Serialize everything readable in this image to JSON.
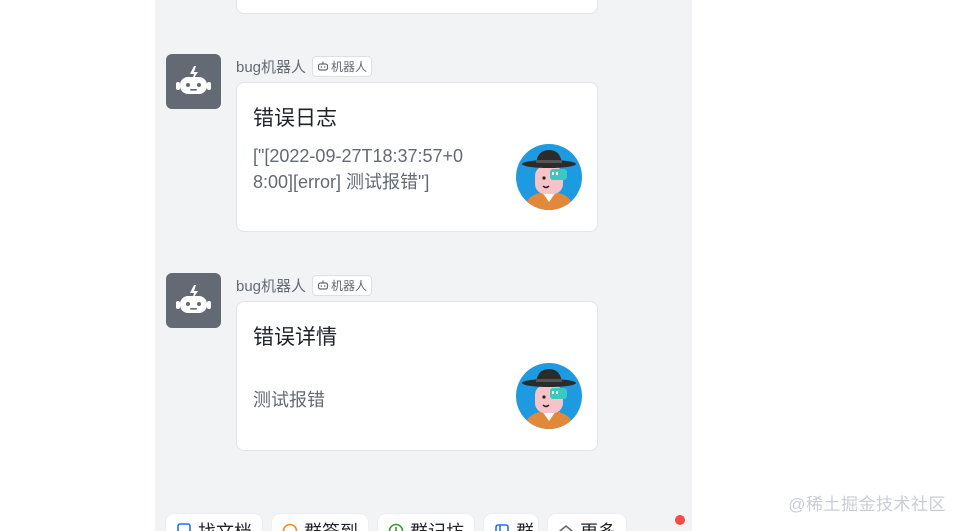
{
  "messages": [
    {
      "sender": "bug机器人",
      "tag": "机器人",
      "card_title": "错误日志",
      "card_body": "[\"[2022-09-27T18:37:57+08:00][error] 测试报错\"]"
    },
    {
      "sender": "bug机器人",
      "tag": "机器人",
      "card_title": "错误详情",
      "card_body": "测试报错"
    }
  ],
  "action_bar": {
    "items": [
      {
        "label": "找文档",
        "icon": "doc-icon"
      },
      {
        "label": "群签到",
        "icon": "checkin-icon"
      },
      {
        "label": "群记坊",
        "icon": "note-icon"
      },
      {
        "label": "群",
        "icon": "group-icon"
      },
      {
        "label": "更多",
        "icon": "more-icon"
      }
    ]
  },
  "watermark": "@稀土掘金技术社区",
  "colors": {
    "panel_bg": "#f2f3f5",
    "avatar_bg": "#646a73",
    "accent_blue": "#1e9be0",
    "red_dot": "#f54a45"
  }
}
